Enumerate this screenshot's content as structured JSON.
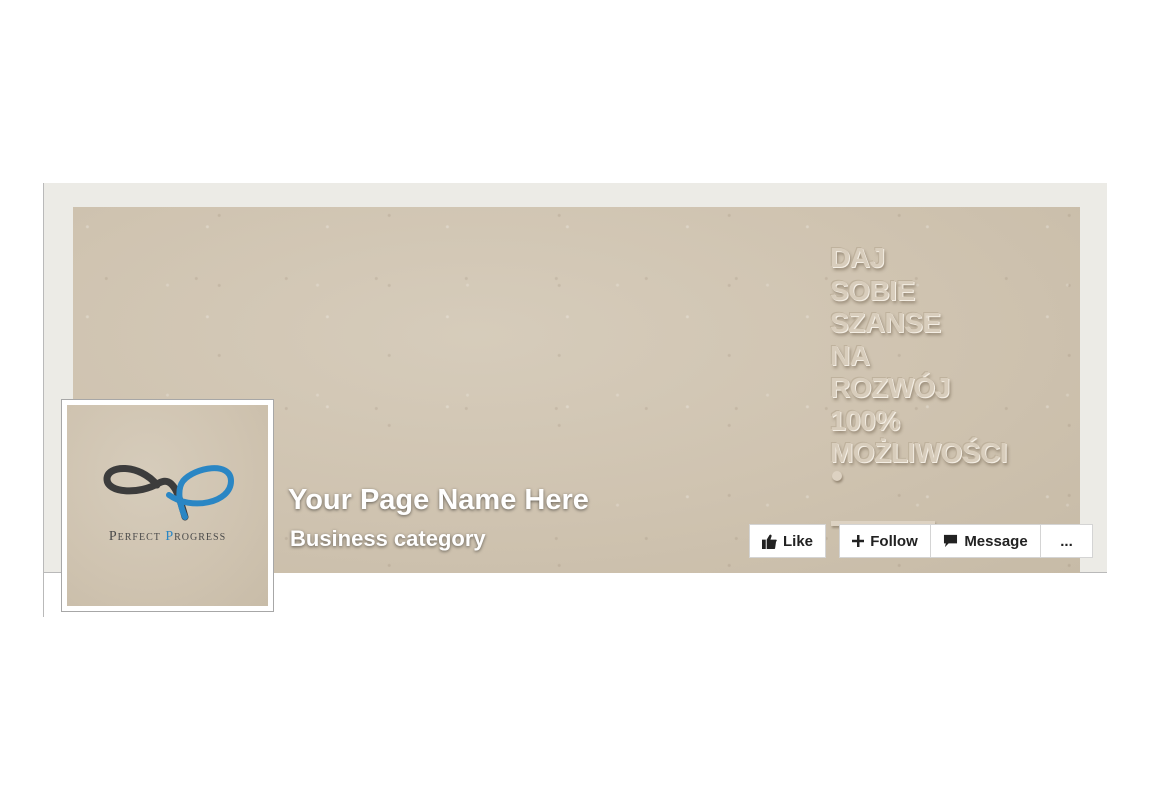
{
  "page": {
    "name": "Your Page Name Here",
    "category": "Business category"
  },
  "cover": {
    "slogan_lines": [
      "DAJ",
      "SOBIE",
      "SZANSE",
      "NA",
      "ROZWÓJ",
      "100%",
      "MOŻLIWOŚCI"
    ]
  },
  "profile": {
    "logo_word_1": "Perfect",
    "logo_word_2_first": "P",
    "logo_word_2_rest": "rogress",
    "accent_color": "#2a86c4"
  },
  "actions": {
    "like_label": "Like",
    "follow_label": "Follow",
    "message_label": "Message",
    "more_label": "..."
  },
  "icons": {
    "like": "thumbs-up-icon",
    "follow": "plus-icon",
    "message": "speech-bubble-icon"
  }
}
